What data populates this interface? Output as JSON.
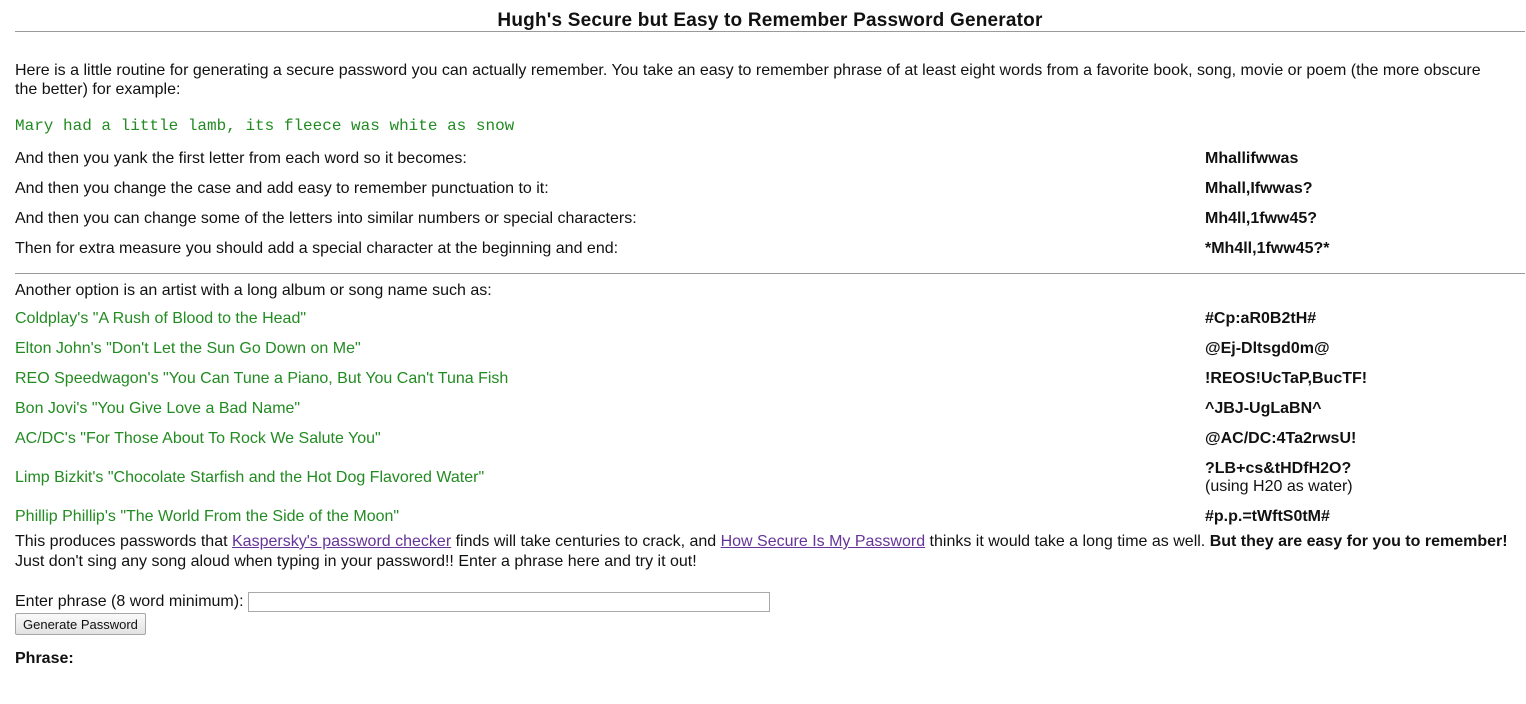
{
  "title": "Hugh's Secure but Easy to Remember Password Generator",
  "intro": "Here is a little routine for generating a secure password you can actually remember. You take an easy to remember phrase of at least eight words from a favorite book, song, movie or poem (the more obscure the better) for example:",
  "example_phrase": "Mary had a little lamb, its fleece was white as snow",
  "steps": [
    {
      "text": "And then you yank the first letter from each word so it becomes:",
      "result": "Mhallifwwas"
    },
    {
      "text": "And then you change the case and add easy to remember punctuation to it:",
      "result": "Mhall,Ifwwas?"
    },
    {
      "text": "And then you can change some of the letters into similar numbers or special characters:",
      "result": "Mh4ll,1fww45?"
    },
    {
      "text": "Then for extra measure you should add a special character at the beginning and end:",
      "result": "*Mh4ll,1fww45?*"
    }
  ],
  "another_option": "Another option is an artist with a long album or song name such as:",
  "examples": [
    {
      "song": "Coldplay's \"A Rush of Blood to the Head\"",
      "password": "#Cp:aR0B2tH#"
    },
    {
      "song": "Elton John's \"Don't Let the Sun Go Down on Me\"",
      "password": "@Ej-Dltsgd0m@"
    },
    {
      "song": "REO Speedwagon's \"You Can Tune a Piano, But You Can't Tuna Fish",
      "password": "!REOS!UcTaP,BucTF!"
    },
    {
      "song": "Bon Jovi's \"You Give Love a Bad Name\"",
      "password": "^JBJ-UgLaBN^"
    },
    {
      "song": "AC/DC's \"For Those About To Rock We Salute You\"",
      "password": "@AC/DC:4Ta2rwsU!"
    },
    {
      "song": "Limp Bizkit's \"Chocolate Starfish and the Hot Dog Flavored Water\"",
      "password": "?LB+cs&tHDfH2O?",
      "note": "(using H20 as water)"
    },
    {
      "song": "Phillip Phillip's \"The World From the Side of the Moon\"",
      "password": "#p.p.=tWftS0tM#"
    }
  ],
  "outro": {
    "part1": "This produces passwords that ",
    "link1": "Kaspersky's password checker",
    "part2": " finds will take centuries to crack, and ",
    "link2": "How Secure Is My Password",
    "part3": " thinks it would take a long time as well. ",
    "bold": "But they are easy for you to remember!",
    "part4": " Just don't sing any song aloud when typing in your password!! Enter a phrase here and try it out!"
  },
  "form": {
    "label": "Enter phrase (8 word minimum):",
    "input_value": "",
    "button_label": "Generate Password"
  },
  "phrase_label": "Phrase:",
  "colors": {
    "example_green": "#228b22",
    "link_visited": "#663399"
  }
}
